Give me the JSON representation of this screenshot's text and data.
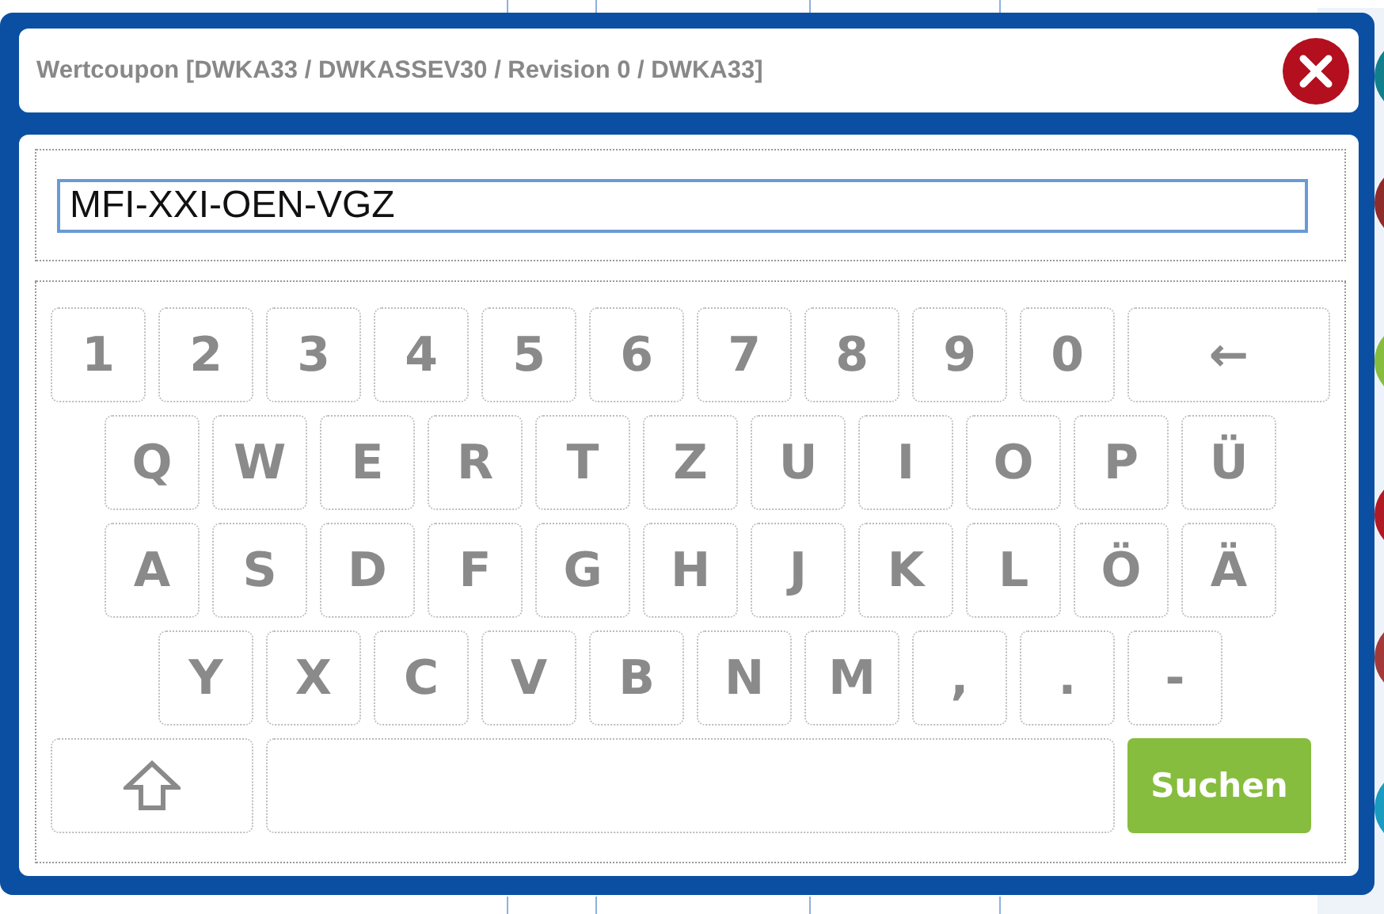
{
  "dialog": {
    "title": "Wertcoupon [DWKA33 / DWKASSEV30 / Revision 0 / DWKA33]"
  },
  "input": {
    "value": "MFI-XXI-OEN-VGZ"
  },
  "keyboard": {
    "rows": [
      [
        {
          "kind": "char",
          "label": "1"
        },
        {
          "kind": "char",
          "label": "2"
        },
        {
          "kind": "char",
          "label": "3"
        },
        {
          "kind": "char",
          "label": "4"
        },
        {
          "kind": "char",
          "label": "5"
        },
        {
          "kind": "char",
          "label": "6"
        },
        {
          "kind": "char",
          "label": "7"
        },
        {
          "kind": "char",
          "label": "8"
        },
        {
          "kind": "char",
          "label": "9"
        },
        {
          "kind": "char",
          "label": "0"
        },
        {
          "kind": "backspace",
          "label": "←"
        }
      ],
      [
        {
          "kind": "char",
          "label": "Q"
        },
        {
          "kind": "char",
          "label": "W"
        },
        {
          "kind": "char",
          "label": "E"
        },
        {
          "kind": "char",
          "label": "R"
        },
        {
          "kind": "char",
          "label": "T"
        },
        {
          "kind": "char",
          "label": "Z"
        },
        {
          "kind": "char",
          "label": "U"
        },
        {
          "kind": "char",
          "label": "I"
        },
        {
          "kind": "char",
          "label": "O"
        },
        {
          "kind": "char",
          "label": "P"
        },
        {
          "kind": "char",
          "label": "Ü"
        }
      ],
      [
        {
          "kind": "char",
          "label": "A"
        },
        {
          "kind": "char",
          "label": "S"
        },
        {
          "kind": "char",
          "label": "D"
        },
        {
          "kind": "char",
          "label": "F"
        },
        {
          "kind": "char",
          "label": "G"
        },
        {
          "kind": "char",
          "label": "H"
        },
        {
          "kind": "char",
          "label": "J"
        },
        {
          "kind": "char",
          "label": "K"
        },
        {
          "kind": "char",
          "label": "L"
        },
        {
          "kind": "char",
          "label": "Ö"
        },
        {
          "kind": "char",
          "label": "Ä"
        }
      ],
      [
        {
          "kind": "char",
          "label": "Y"
        },
        {
          "kind": "char",
          "label": "X"
        },
        {
          "kind": "char",
          "label": "C"
        },
        {
          "kind": "char",
          "label": "V"
        },
        {
          "kind": "char",
          "label": "B"
        },
        {
          "kind": "char",
          "label": "N"
        },
        {
          "kind": "char",
          "label": "M"
        },
        {
          "kind": "char",
          "label": ","
        },
        {
          "kind": "char",
          "label": "."
        },
        {
          "kind": "char",
          "label": "-"
        }
      ]
    ],
    "search_button": {
      "label": "Suchen"
    }
  }
}
